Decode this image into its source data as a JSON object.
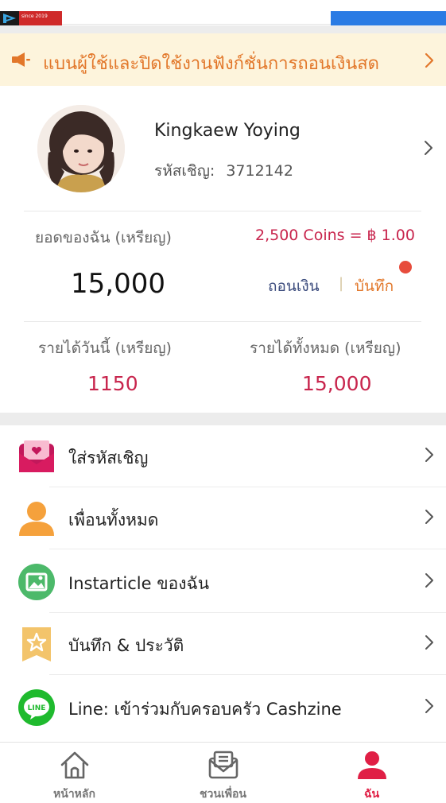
{
  "app_logo": {
    "name": "app-logo",
    "text": "since 2019"
  },
  "notice": {
    "icon": "speaker-icon",
    "text": "แบนผู้ใช้และปิดใช้งานฟังก์ชั่นการถอนเงินสด"
  },
  "profile": {
    "name": "Kingkaew Yoying",
    "invite_label": "รหัสเชิญ:",
    "invite_code": "3712142"
  },
  "balance": {
    "label": "ยอดของฉัน (เหรียญ)",
    "rate": "2,500 Coins = ฿ 1.00",
    "value": "15,000",
    "withdraw_label": "ถอนเงิน",
    "separator": "|",
    "record_label": "บันทึก"
  },
  "earnings": {
    "today_label": "รายได้วันนี้ (เหรียญ)",
    "today_value": "1150",
    "total_label": "รายได้ทั้งหมด (เหรียญ)",
    "total_value": "15,000"
  },
  "menu": {
    "items": [
      {
        "label": "ใส่รหัสเชิญ",
        "icon": "invite-envelope-icon"
      },
      {
        "label": "เพื่อนทั้งหมด",
        "icon": "friend-person-icon"
      },
      {
        "label": "Instarticle ของฉัน",
        "icon": "image-icon"
      },
      {
        "label": "บันทึก & ประวัติ",
        "icon": "star-bookmark-icon"
      },
      {
        "label": "Line: เข้าร่วมกับครอบครัว Cashzine",
        "icon": "line-icon"
      }
    ]
  },
  "bottom_nav": {
    "items": [
      {
        "label": "หน้าหลัก",
        "icon": "home-icon"
      },
      {
        "label": "ชวนเพื่อน",
        "icon": "invite-mail-icon"
      },
      {
        "label": "ฉัน",
        "icon": "me-person-icon"
      }
    ]
  },
  "colors": {
    "accent_red": "#c8254d",
    "nav_active": "#e01f45",
    "notice_bg": "#fdf4dc",
    "notice_text": "#e2772a",
    "link_blue": "#3a4a7c"
  }
}
